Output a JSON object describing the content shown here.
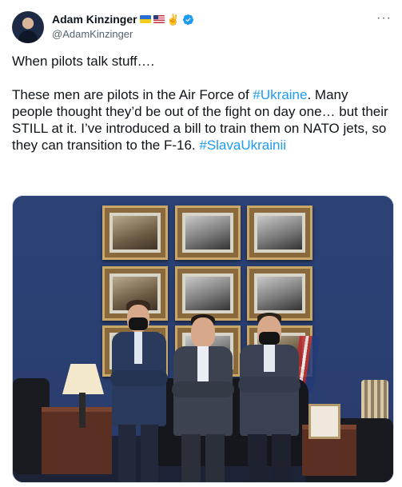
{
  "tweet": {
    "author_name": "Adam Kinzinger",
    "handle": "@AdamKinzinger",
    "more_label": "···",
    "icons": [
      "ukraine-flag-icon",
      "usa-flag-icon",
      "victory-hand-icon",
      "verified-badge-icon",
      "more-options-icon"
    ],
    "line1": "When pilots talk stuff….",
    "body_before_tag1": "These men are pilots in the Air Force of ",
    "tag1": "#Ukraine",
    "body_after_tag1": ". Many people thought they’d be out of the fight on day one… but their STILL at it.  I’ve introduced a bill to train them on NATO jets, so they can transition to the F-16. ",
    "tag2": "#SlavaUkrainii",
    "victory_hand": "✌️"
  },
  "colors": {
    "link": "#1d9bf0",
    "verified": "#1d9bf0",
    "secondary_text": "#536471"
  }
}
